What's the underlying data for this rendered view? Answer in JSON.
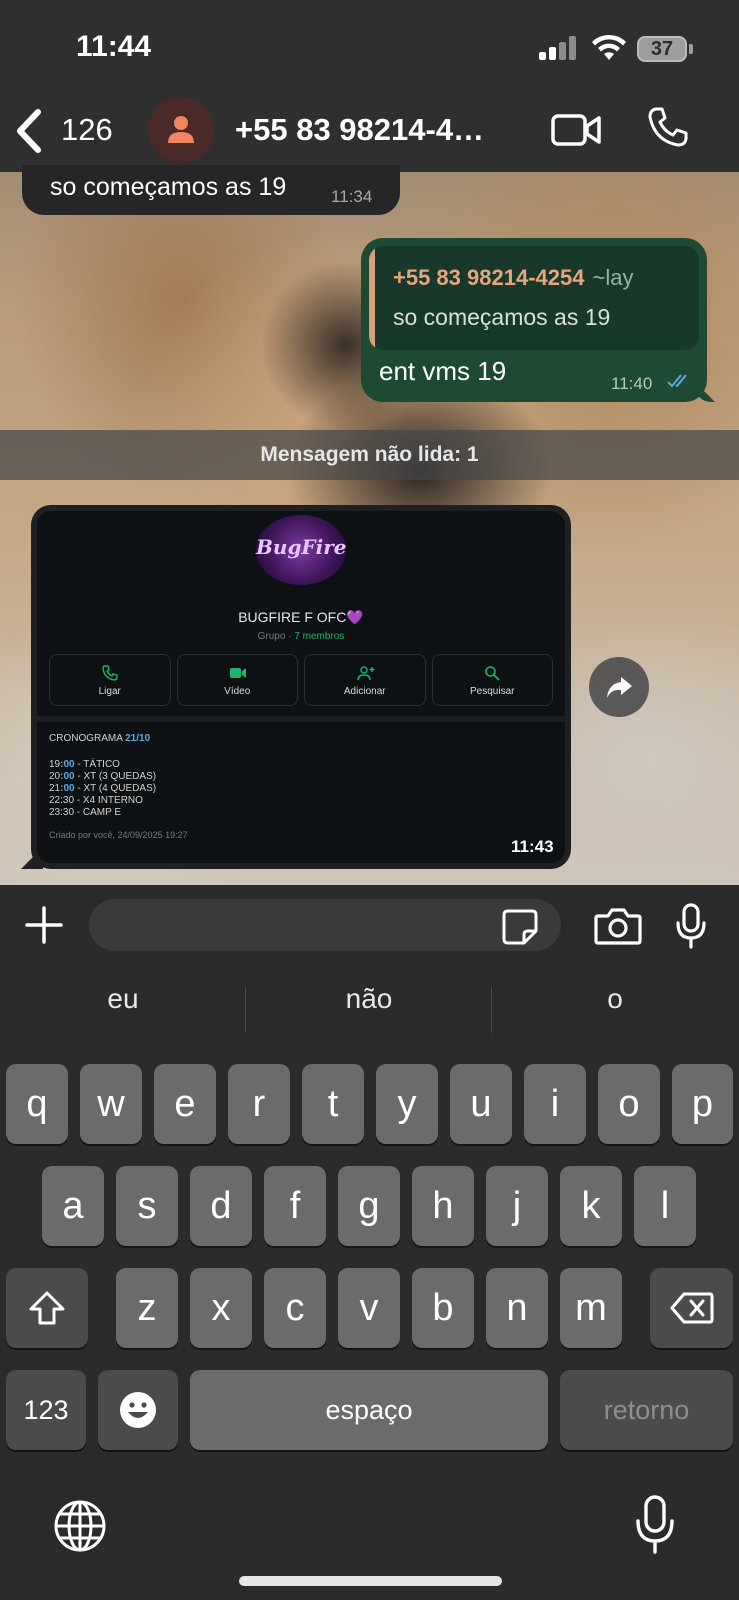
{
  "status_bar": {
    "time": "11:44",
    "battery": "37"
  },
  "header": {
    "back_count": "126",
    "contact_name": "+55 83 98214-4…"
  },
  "messages": [
    {
      "direction": "incoming",
      "text": "so começamos as 19",
      "time": "11:34"
    },
    {
      "direction": "outgoing",
      "quote_author": "+55 83 98214-4254",
      "quote_author_tag": "~lay",
      "quote_text": "so começamos as 19",
      "text": "ent vms 19",
      "time": "11:40"
    }
  ],
  "unread_banner": "Mensagem não lida: 1",
  "image_message": {
    "time": "11:43",
    "screenshot": {
      "avatar_text": "BugFire",
      "group_name": "BUGFIRE F OFC💜",
      "group_type": "Grupo ·",
      "members": "7 membros",
      "actions": [
        "Ligar",
        "Vídeo",
        "Adicionar",
        "Pesquisar"
      ],
      "schedule_title": "CRONOGRAMA",
      "schedule_date": "21/10",
      "schedule": [
        {
          "hour": "19",
          "min": ":00",
          "label": " - TÁTICO"
        },
        {
          "hour": "20",
          "min": ":00",
          "label": " - XT (3 QUEDAS)"
        },
        {
          "hour": "21",
          "min": ":00",
          "label": " - XT (4 QUEDAS)"
        },
        {
          "hour": "22",
          "min": ":30",
          "label": " - X4 INTERNO"
        },
        {
          "hour": "23",
          "min": ":30",
          "label": " - CAMP E"
        }
      ],
      "created": "Criado por você, 24/09/2025 19:27"
    }
  },
  "input": {
    "placeholder": ""
  },
  "keyboard": {
    "suggestions": [
      "eu",
      "não",
      "o"
    ],
    "row1": [
      "q",
      "w",
      "e",
      "r",
      "t",
      "y",
      "u",
      "i",
      "o",
      "p"
    ],
    "row2": [
      "a",
      "s",
      "d",
      "f",
      "g",
      "h",
      "j",
      "k",
      "l"
    ],
    "row3": [
      "z",
      "x",
      "c",
      "v",
      "b",
      "n",
      "m"
    ],
    "numbers_key": "123",
    "space_key": "espaço",
    "return_key": "retorno"
  },
  "colors": {
    "outgoing_bubble": "#1e4a34",
    "incoming_bubble": "#262628",
    "quote_author": "#e8a47d",
    "accent_green": "#1fb36b",
    "read_ticks": "#5fa8e0"
  }
}
